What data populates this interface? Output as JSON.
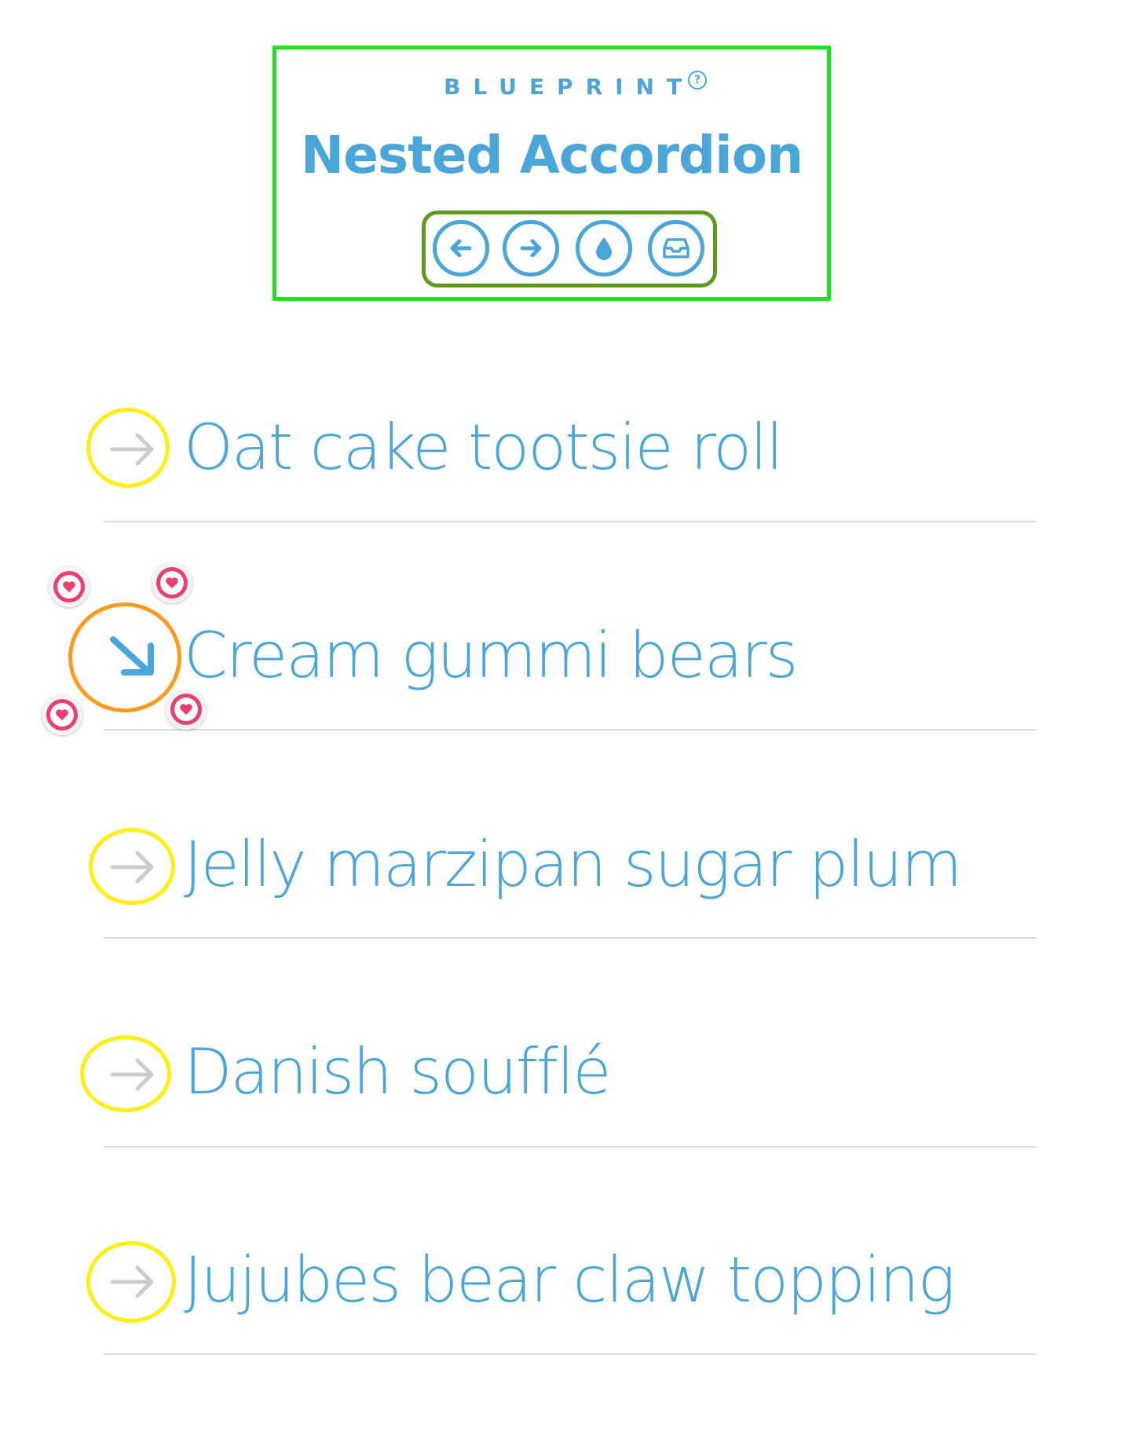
{
  "header": {
    "brand": "BLUEPRINT",
    "help_symbol": "?",
    "title": "Nested Accordion",
    "toolbar": [
      {
        "name": "back-arrow-icon"
      },
      {
        "name": "forward-arrow-icon"
      },
      {
        "name": "drop-icon"
      },
      {
        "name": "inbox-icon"
      }
    ]
  },
  "accordion": {
    "items": [
      {
        "label": "Oat cake tootsie roll",
        "state": "collapsed"
      },
      {
        "label": "Cream gummi bears",
        "state": "expanded"
      },
      {
        "label": "Jelly marzipan sugar plum",
        "state": "collapsed"
      },
      {
        "label": "Danish soufflé",
        "state": "collapsed"
      },
      {
        "label": "Jujubes bear claw topping",
        "state": "collapsed"
      }
    ]
  },
  "colors": {
    "accent": "#4aa6d9",
    "collapsed_arrow": "#cccccc",
    "header_box_border": "#1ee21e",
    "toolbar_border": "#5d9a1e",
    "highlight_yellow": "#ffee11",
    "highlight_orange": "#ff9a1a",
    "heart_badge": "#ec3e70",
    "divider": "#dcdcdc"
  }
}
